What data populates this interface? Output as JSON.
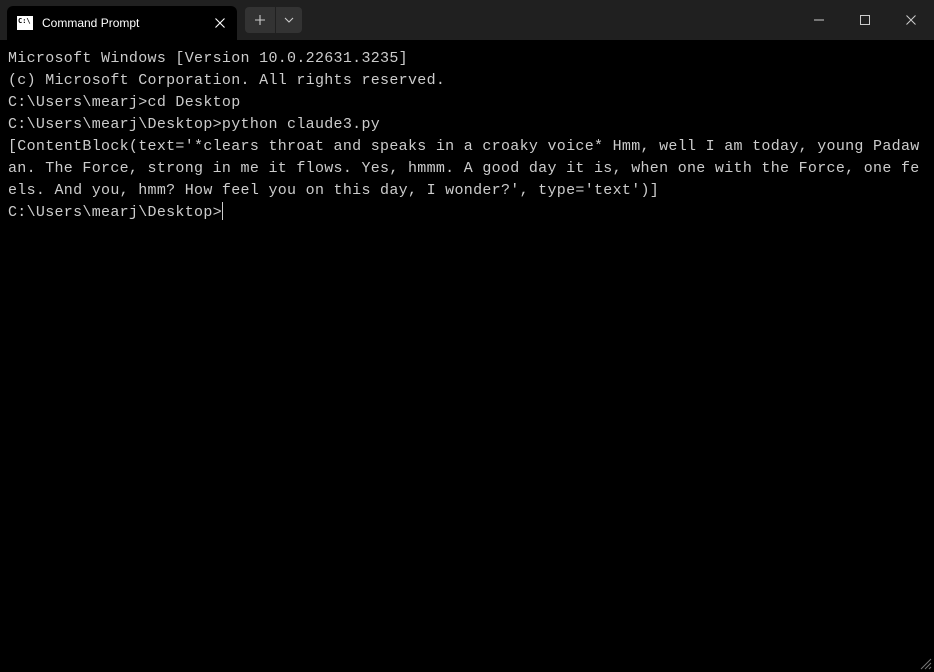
{
  "titlebar": {
    "tab_title": "Command Prompt"
  },
  "terminal": {
    "lines": [
      "Microsoft Windows [Version 10.0.22631.3235]",
      "(c) Microsoft Corporation. All rights reserved.",
      "",
      "C:\\Users\\mearj>cd Desktop",
      "",
      "C:\\Users\\mearj\\Desktop>python claude3.py",
      "[ContentBlock(text='*clears throat and speaks in a croaky voice* Hmm, well I am today, young Padawan. The Force, strong in me it flows. Yes, hmmm. A good day it is, when one with the Force, one feels. And you, hmm? How feel you on this day, I wonder?', type='text')]",
      ""
    ],
    "current_prompt": "C:\\Users\\mearj\\Desktop>"
  }
}
